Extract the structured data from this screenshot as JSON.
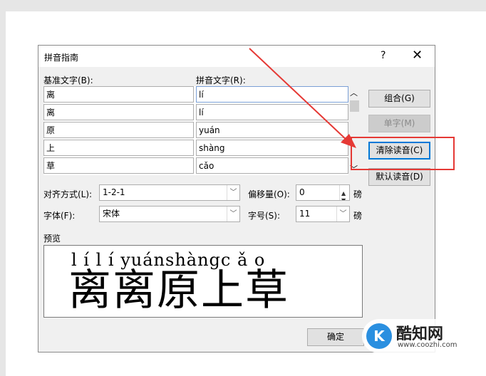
{
  "dialog": {
    "title": "拼音指南",
    "help_icon": "?",
    "close_icon": "✕"
  },
  "labels": {
    "base_text": "基准文字(B):",
    "pinyin_text": "拼音文字(R):",
    "alignment": "对齐方式(L):",
    "offset": "偏移量(O):",
    "font": "字体(F):",
    "font_size": "字号(S):",
    "preview": "预览"
  },
  "rows": [
    {
      "base": "离",
      "pinyin": "lí"
    },
    {
      "base": "离",
      "pinyin": "lí"
    },
    {
      "base": "原",
      "pinyin": "yuán"
    },
    {
      "base": "上",
      "pinyin": "shàng"
    },
    {
      "base": "草",
      "pinyin": "cǎo"
    }
  ],
  "buttons": {
    "group": "组合(G)",
    "single": "单字(M)",
    "clear": "清除读音(C)",
    "default": "默认读音(D)",
    "ok": "确定"
  },
  "fields": {
    "alignment_value": "1-2-1",
    "offset_value": "0",
    "offset_unit": "磅",
    "font_value": "宋体",
    "font_size_value": "11",
    "font_size_unit": "磅"
  },
  "preview": {
    "pinyin": "l í   l í  yuánshàngc ǎ o",
    "hanzi": "离离原上草"
  },
  "watermark": {
    "name": "酷知网",
    "url": "www.coozhi.com"
  },
  "colors": {
    "annotation": "#e53935",
    "focus": "#0078d7"
  }
}
